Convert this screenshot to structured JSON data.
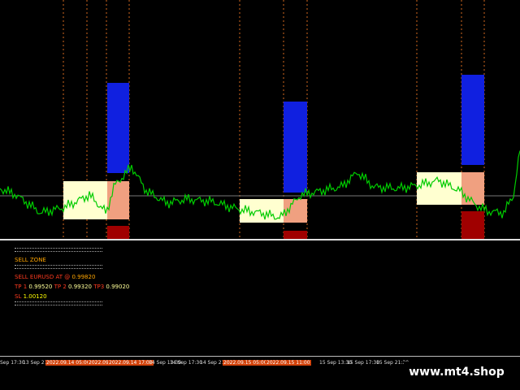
{
  "colors": {
    "background": "#000000",
    "price_line": "#00cc00",
    "sell_zone": "#ffffd0",
    "target_zone": "#f0a080",
    "blue_bar": "#1020e0",
    "stop_bar": "#a00000",
    "vline": "#d2691e",
    "accent": "#ffa500"
  },
  "panel": {
    "title": "SELL ZONE",
    "sell_label": "SELL EURUSD AT @",
    "sell_value": "0.99820",
    "tp1_label": "TP 1",
    "tp1_value": "0.99520",
    "tp2_label": "TP 2",
    "tp2_value": "0.99320",
    "tp3_label": "TP3",
    "tp3_value": "0.99020",
    "sl_label": "SL",
    "sl_value": "1.00120"
  },
  "time_axis": {
    "labels": [
      {
        "text": "Sep 17:30",
        "hl": false
      },
      {
        "text": "13 Sep 21:30",
        "hl": false
      },
      {
        "text": "2022.09.14 05:00",
        "hl": true
      },
      {
        "text": "2022.09.14 11:00",
        "hl": true
      },
      {
        "text": "2022.09.14 17:00",
        "hl": true
      },
      {
        "text": "14 Sep 13:30",
        "hl": false
      },
      {
        "text": "14 Sep 17:30",
        "hl": false
      },
      {
        "text": "14 Sep 21:30",
        "hl": false
      },
      {
        "text": "2022.09.15 05:00",
        "hl": true
      },
      {
        "text": "2022.09.15 11:00",
        "hl": true
      },
      {
        "text": "15 Sep 13:30",
        "hl": false
      },
      {
        "text": "15 Sep 17:30",
        "hl": false
      },
      {
        "text": "15 Sep 21:30",
        "hl": false
      }
    ]
  },
  "watermark": "www.mt4.shop"
}
